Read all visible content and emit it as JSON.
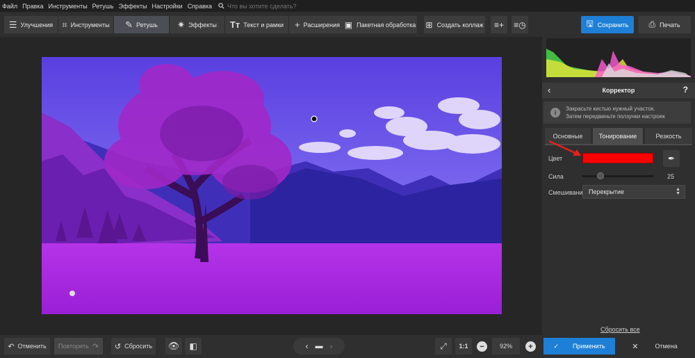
{
  "menu": [
    "Файл",
    "Правка",
    "Инструменты",
    "Ретушь",
    "Эффекты",
    "Настройки",
    "Справка"
  ],
  "search": {
    "placeholder": "Что вы хотите сделать?"
  },
  "tabs": [
    {
      "label": "Улучшения",
      "icon": "sliders-icon"
    },
    {
      "label": "Инструменты",
      "icon": "crop-icon"
    },
    {
      "label": "Ретушь",
      "icon": "brush-icon"
    },
    {
      "label": "Эффекты",
      "icon": "sparkle-icon"
    },
    {
      "label": "Текст и рамки",
      "icon": "text-icon"
    },
    {
      "label": "Расширения",
      "icon": "plus-icon"
    }
  ],
  "toolbar": {
    "batch": "Пакетная обработка",
    "collage": "Создать коллаж",
    "save": "Сохранить",
    "print": "Печать"
  },
  "panel": {
    "title": "Корректор",
    "help": "?",
    "info_line1": "Закрасьте кистью нужный участок.",
    "info_line2": "Затем передвиньте ползунки настроек",
    "subtabs": [
      "Основные",
      "Тонирование",
      "Резкость"
    ],
    "active_subtab": 1,
    "color_label": "Цвет",
    "color_value": "#ff0000",
    "strength_label": "Сила",
    "strength_value": "25",
    "strength_fraction": 0.25,
    "blend_label": "Смешивание",
    "blend_value": "Перекрытие",
    "reset_all": "Сбросить все",
    "apply": "Применить",
    "cancel": "Отмена"
  },
  "bottom": {
    "undo": "Отменить",
    "redo": "Повторить",
    "reset": "Сбросить",
    "zoom_ratio": "1:1",
    "zoom": "92%"
  },
  "colors": {
    "accent": "#1e7fd6",
    "swatch": "#ff0000",
    "arrow": "#e8201c"
  }
}
